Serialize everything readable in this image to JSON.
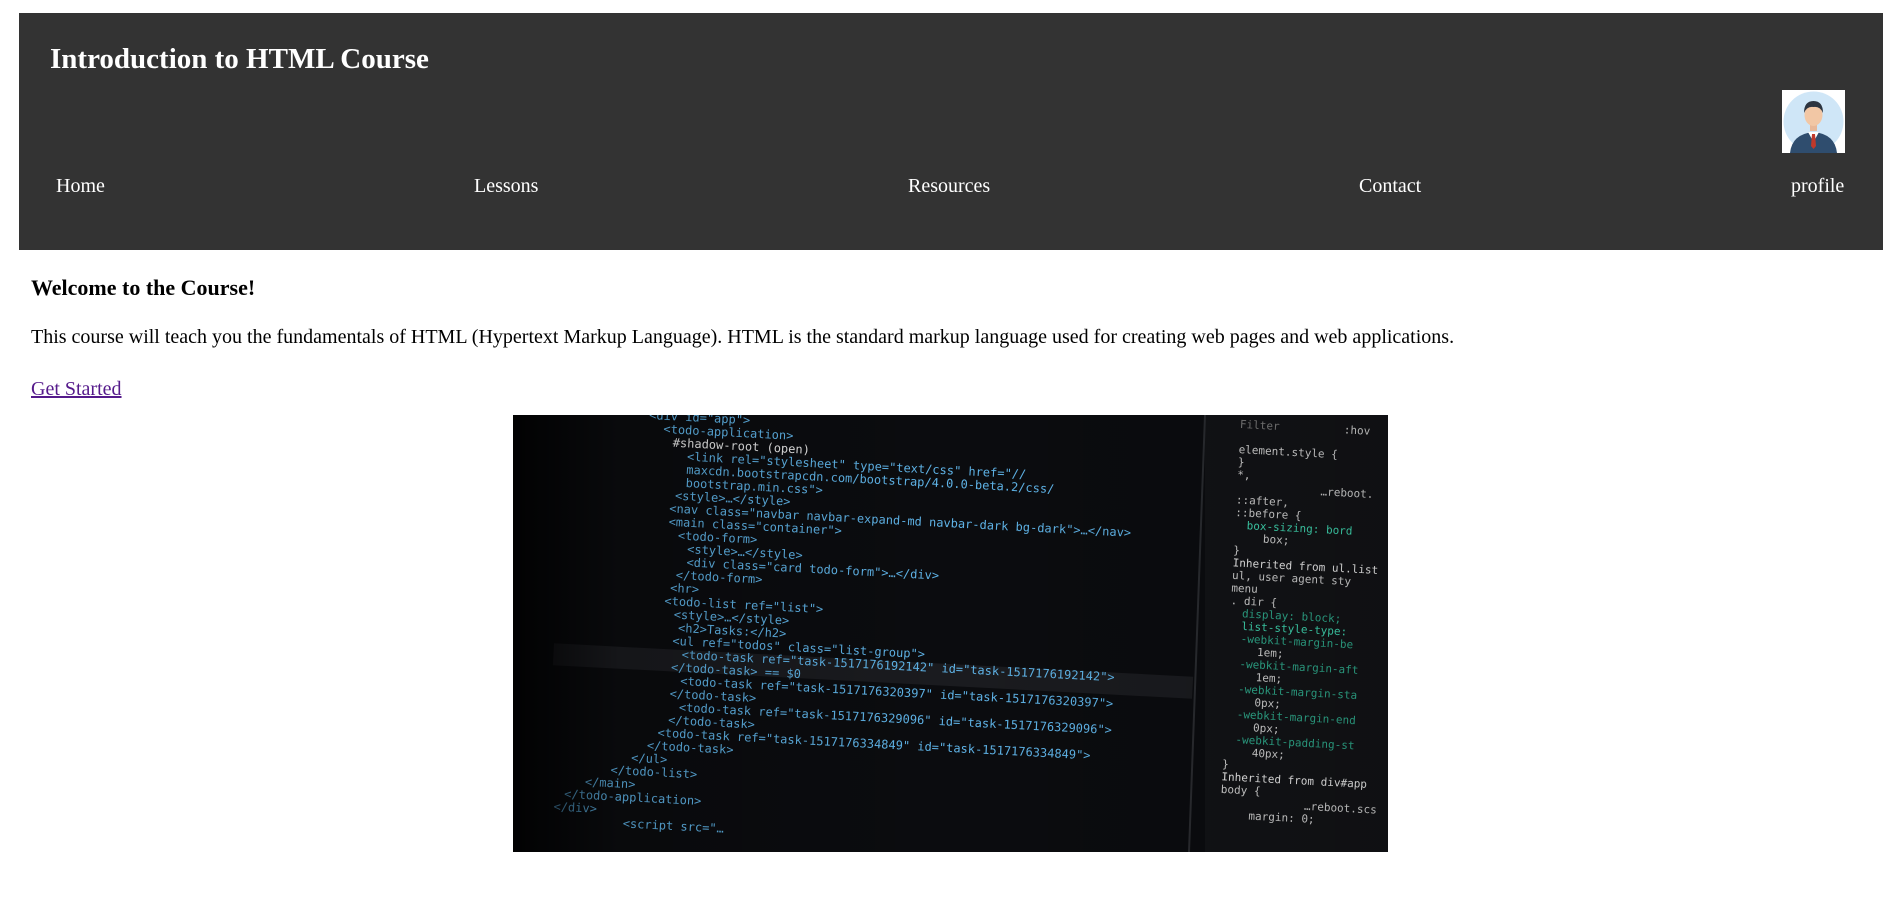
{
  "header": {
    "title": "Introduction to HTML Course",
    "avatar_icon": "user-avatar-icon"
  },
  "nav": {
    "items": [
      {
        "label": "Home"
      },
      {
        "label": "Lessons"
      },
      {
        "label": "Resources"
      },
      {
        "label": "Contact"
      },
      {
        "label": "profile"
      }
    ]
  },
  "main": {
    "heading": "Welcome to the Course!",
    "intro": "This course will teach you the fundamentals of HTML (Hypertext Markup Language). HTML is the standard markup language used for creating web pages and web applications.",
    "cta_label": "Get Started"
  },
  "hero_image": {
    "icon": "code-screenshot-image",
    "dom_lines": [
      "<div id=\"app\">",
      "<todo-application>",
      "#shadow-root (open)",
      "<link rel=\"stylesheet\" type=\"text/css\" href=\"//",
      "maxcdn.bootstrapcdn.com/bootstrap/4.0.0-beta.2/css/",
      "bootstrap.min.css\">",
      "<style>…</style>",
      "<nav class=\"navbar navbar-expand-md navbar-dark bg-dark\">…</nav>",
      "<main class=\"container\">",
      "<todo-form>",
      "<style>…</style>",
      "<div class=\"card todo-form\">…</div>",
      "</todo-form>",
      "<hr>",
      "<todo-list ref=\"list\">",
      "<style>…</style>",
      "<h2>Tasks:</h2>",
      "<ul ref=\"todos\" class=\"list-group\">",
      "<todo-task ref=\"task-1517176192142\" id=\"task-1517176192142\">",
      "</todo-task> == $0",
      "<todo-task ref=\"task-1517176320397\" id=\"task-1517176320397\">",
      "</todo-task>",
      "<todo-task ref=\"task-1517176329096\" id=\"task-1517176329096\">",
      "</todo-task>",
      "<todo-task ref=\"task-1517176334849\" id=\"task-1517176334849\">",
      "</todo-task>",
      "</ul>",
      "</todo-list>",
      "</main>",
      "</todo-application>",
      "</div>",
      "<script src=\"…"
    ],
    "style_lines": [
      "Filter",
      ":hov",
      "element.style {",
      "}",
      "*,",
      "…reboot.",
      "::after,",
      "::before {",
      "box-sizing: bord",
      "box;",
      "}",
      "Inherited from ul.list",
      "ul, user agent sty",
      "menu",
      ". dir {",
      "display: block;",
      "list-style-type:",
      "-webkit-margin-be",
      "1em;",
      "-webkit-margin-aft",
      "1em;",
      "-webkit-margin-sta",
      "0px;",
      "-webkit-margin-end",
      "0px;",
      "-webkit-padding-st",
      "40px;",
      "}",
      "Inherited from div#app",
      "body {",
      "…reboot.scs",
      "margin: 0;"
    ]
  }
}
